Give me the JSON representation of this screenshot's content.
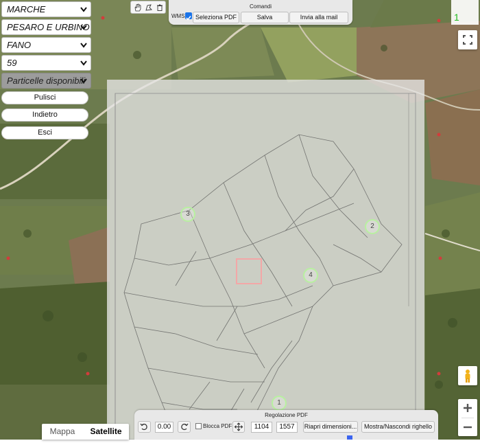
{
  "region_select": {
    "value": "MARCHE"
  },
  "province_select": {
    "value": "PESARO E URBINO"
  },
  "comune_select": {
    "value": "FANO"
  },
  "foglio_select": {
    "value": "59"
  },
  "particelle_select": {
    "value": "Particelle disponibili"
  },
  "buttons_left": {
    "pulisci": "Pulisci",
    "indietro": "Indietro",
    "esci": "Esci"
  },
  "commands": {
    "title": "Comandi",
    "wms_label": "WMS",
    "wms_checked": true,
    "select_pdf": "Seleziona PDF",
    "save": "Salva",
    "send_mail": "Invia alla mail"
  },
  "counter_badge": "1",
  "regolazione": {
    "title": "Regolazione PDF",
    "rotation_value": "0.00",
    "lock_label": "Blocca PDF",
    "width_value": "1104",
    "height_value": "1557",
    "resize_button": "Riapri dimensioni...",
    "ruler_button": "Mostra/Nascondi righello"
  },
  "map_type": {
    "map": "Mappa",
    "satellite": "Satellite",
    "active": "Satellite"
  },
  "clusters": [
    "3",
    "2",
    "4",
    "1"
  ],
  "colors": {
    "accent_green": "#17c117",
    "cluster_ring": "#b8f0a0",
    "red_marker": "#f3a7a7"
  }
}
